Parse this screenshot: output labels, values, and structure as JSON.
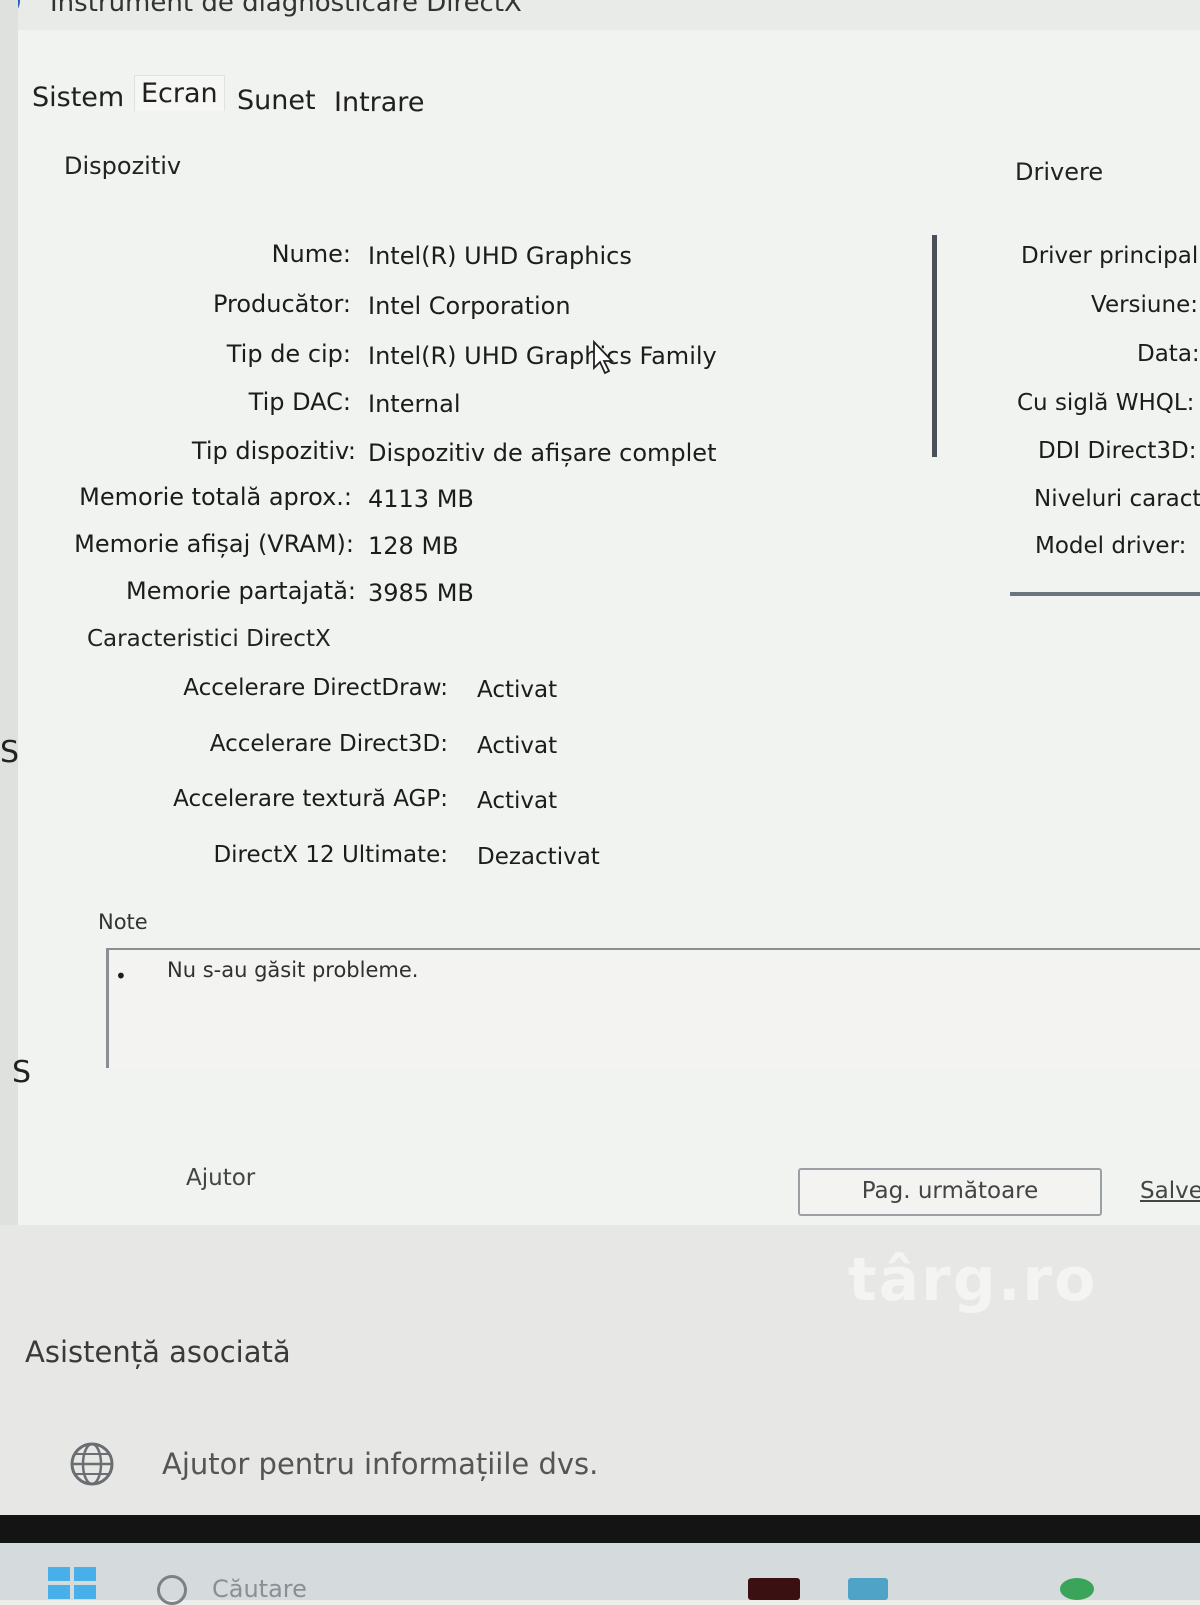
{
  "window": {
    "title": "Instrument de diagnosticare DirectX"
  },
  "tabs": [
    {
      "label": "Sistem",
      "active": false
    },
    {
      "label": "Ecran",
      "active": true
    },
    {
      "label": "Sunet",
      "active": false
    },
    {
      "label": "Intrare",
      "active": false
    }
  ],
  "device": {
    "group_label": "Dispozitiv",
    "fields": [
      {
        "label": "Nume:",
        "value": "Intel(R) UHD Graphics"
      },
      {
        "label": "Producător:",
        "value": "Intel Corporation"
      },
      {
        "label": "Tip de cip:",
        "value": "Intel(R) UHD Graphics Family"
      },
      {
        "label": "Tip DAC:",
        "value": "Internal"
      },
      {
        "label": "Tip dispozitiv:",
        "value": "Dispozitiv de afișare complet"
      },
      {
        "label": "Memorie totală aprox.:",
        "value": "4113 MB"
      },
      {
        "label": "Memorie afișaj (VRAM):",
        "value": "128 MB"
      },
      {
        "label": "Memorie partajată:",
        "value": "3985 MB"
      }
    ]
  },
  "directx": {
    "group_label": "Caracteristici DirectX",
    "features": [
      {
        "label": "Accelerare DirectDraw:",
        "value": "Activat"
      },
      {
        "label": "Accelerare Direct3D:",
        "value": "Activat"
      },
      {
        "label": "Accelerare textură AGP:",
        "value": "Activat"
      },
      {
        "label": "DirectX 12 Ultimate:",
        "value": "Dezactivat"
      }
    ]
  },
  "drivers": {
    "group_label": "Drivere",
    "labels": [
      "Driver principal:",
      "Versiune:",
      "Data:",
      "Cu siglă WHQL:",
      "DDI Direct3D:",
      "Niveluri caracteristici:",
      "Model driver:"
    ]
  },
  "notes": {
    "title": "Note",
    "items": [
      "Nu s-au găsit probleme."
    ]
  },
  "buttons": {
    "help": "Ajutor",
    "next_page": "Pag. următoare",
    "save": "Salvează"
  },
  "side_letters": [
    "S",
    "S"
  ],
  "watermark": "târg.ro",
  "related": {
    "title": "Asistență asociată",
    "link": "Ajutor pentru informațiile dvs."
  },
  "taskbar": {
    "search_placeholder": "Căutare"
  }
}
